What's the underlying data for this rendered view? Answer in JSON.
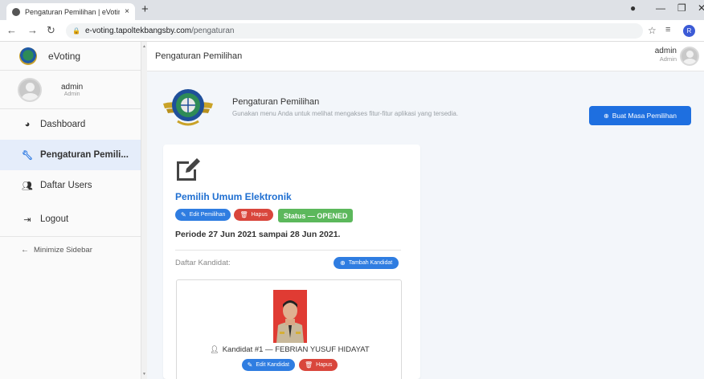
{
  "browser": {
    "tab_title": "Pengaturan Pemilihan | eVoting",
    "tab_close": "×",
    "new_tab": "+",
    "url_host": "e-voting.tapoltekbangsby.com",
    "url_path": "/pengaturan",
    "profile_initial": "R"
  },
  "sidebar": {
    "brand": "eVoting",
    "user_name": "admin",
    "user_role": "Admin",
    "items": [
      {
        "label": "Dashboard",
        "icon": "tachometer-icon"
      },
      {
        "label": "Pengaturan Pemili...",
        "icon": "wrench-icon"
      },
      {
        "label": "Daftar Users",
        "icon": "users-icon"
      },
      {
        "label": "Logout",
        "icon": "sign-out-icon"
      }
    ],
    "minimize": "Minimize Sidebar"
  },
  "topnav": {
    "title": "Pengaturan Pemilihan",
    "user_name": "admin",
    "user_role": "Admin"
  },
  "header": {
    "title": "Pengaturan Pemilihan",
    "subtitle": "Gunakan menu Anda untuk melihat mengakses fitur-fitur aplikasi yang tersedia.",
    "new_button": "Buat Masa Pemilihan"
  },
  "election": {
    "title": "Pemilih Umum Elektronik",
    "edit_label": "Edit Pemilihan",
    "delete_label": "Hapus",
    "status": "Status — OPENED",
    "period": "Periode 27 Jun 2021 sampai 28 Jun 2021.",
    "candidates_label": "Daftar Kandidat:",
    "add_candidate": "Tambah Kandidat"
  },
  "candidates": [
    {
      "label": "Kandidat #1 — FEBRIAN YUSUF HIDAYAT",
      "edit_label": "Edit Kandidat",
      "delete_label": "Hapus"
    }
  ],
  "colors": {
    "primary": "#1e6fe0",
    "danger": "#d9463c",
    "success": "#5cb85c",
    "title_blue": "#1f6fd1"
  }
}
